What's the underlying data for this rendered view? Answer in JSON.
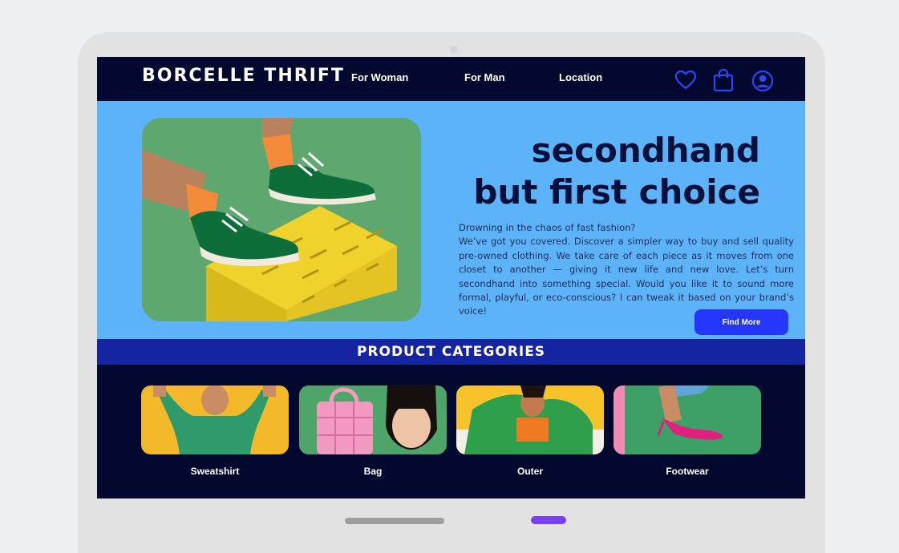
{
  "header": {
    "brand": "BORCELLE THRIFT",
    "nav": [
      "For Woman",
      "For Man",
      "Location"
    ],
    "icons": [
      "heart-icon",
      "shopping-bag-icon",
      "user-account-icon"
    ]
  },
  "hero": {
    "headline_line1": "secondhand",
    "headline_line2": "but first choice",
    "description_line1": "Drowning in the chaos of fast fashion?",
    "description_body": "We’ve got you covered. Discover a simpler way to buy and sell quality pre-owned clothing. We take care of each piece as it moves from one closet to another — giving it new life and new love. Let’s turn secondhand into something special. Would you like it to sound more formal, playful, or eco-conscious? I can tweak it based on your brand’s voice!",
    "cta_label": "Find More"
  },
  "categories": {
    "title": "PRODUCT CATEGORIES",
    "items": [
      {
        "label": "Sweatshirt"
      },
      {
        "label": "Bag"
      },
      {
        "label": "Outer"
      },
      {
        "label": "Footwear"
      }
    ]
  },
  "colors": {
    "navy": "#03082e",
    "hero_blue": "#5db3f7",
    "band_blue": "#1524a0",
    "accent": "#2637fd",
    "text_dark": "#05103d"
  }
}
